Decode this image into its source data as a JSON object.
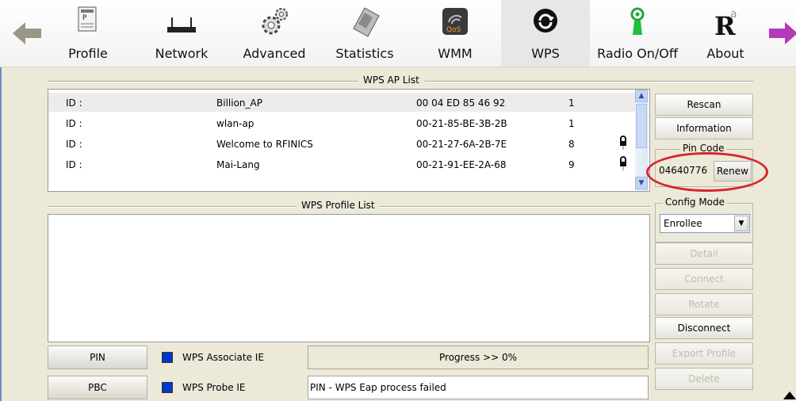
{
  "toolbar": {
    "items": [
      {
        "label": "Profile",
        "icon": "profile-icon"
      },
      {
        "label": "Network",
        "icon": "network-icon"
      },
      {
        "label": "Advanced",
        "icon": "advanced-gears-icon"
      },
      {
        "label": "Statistics",
        "icon": "statistics-calculator-icon"
      },
      {
        "label": "WMM",
        "icon": "wmm-qos-icon"
      },
      {
        "label": "WPS",
        "icon": "wps-icon"
      },
      {
        "label": "Radio On/Off",
        "icon": "radio-antenna-icon"
      },
      {
        "label": "About",
        "icon": "about-r-icon"
      }
    ],
    "active": "WPS"
  },
  "wps_ap_list": {
    "title": "WPS AP List",
    "rows": [
      {
        "id": "ID :",
        "ssid": "Billion_AP",
        "mac": "00 04 ED 85 46 92",
        "channel": "1",
        "locked": false
      },
      {
        "id": "ID :",
        "ssid": "wlan-ap",
        "mac": "00-21-85-BE-3B-2B",
        "channel": "1",
        "locked": false
      },
      {
        "id": "ID :",
        "ssid": "Welcome to RFINICS",
        "mac": "00-21-27-6A-2B-7E",
        "channel": "8",
        "locked": true
      },
      {
        "id": "ID :",
        "ssid": "Mai-Lang",
        "mac": "00-21-91-EE-2A-68",
        "channel": "9",
        "locked": true
      }
    ]
  },
  "wps_profile_list": {
    "title": "WPS Profile List"
  },
  "buttons": {
    "rescan": "Rescan",
    "information": "Information",
    "detail": "Detail",
    "connect": "Connect",
    "rotate": "Rotate",
    "disconnect": "Disconnect",
    "export_profile": "Export Profile",
    "delete": "Delete"
  },
  "pin_code": {
    "title": "Pin Code",
    "value": "04640776",
    "renew": "Renew"
  },
  "config_mode": {
    "title": "Config Mode",
    "selected": "Enrollee"
  },
  "bottom": {
    "pin_button": "PIN",
    "pbc_button": "PBC",
    "associate_ie_label": "WPS Associate IE",
    "probe_ie_label": "WPS Probe IE",
    "associate_ie_checked": true,
    "probe_ie_checked": true,
    "progress": "Progress >> 0%",
    "status": "PIN - WPS Eap process failed"
  },
  "colors": {
    "highlight_ellipse": "#d9232d",
    "checkbox": "#0037c8"
  }
}
